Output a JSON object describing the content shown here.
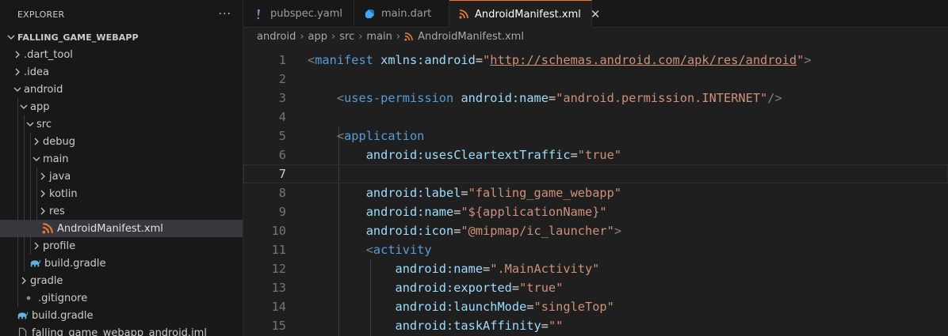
{
  "explorer": {
    "title": "EXPLORER",
    "more": "···",
    "root": "FALLING_GAME_WEBAPP",
    "items": [
      {
        "label": ".dart_tool",
        "state": "closed"
      },
      {
        "label": ".idea",
        "state": "closed"
      },
      {
        "label": "android",
        "state": "open"
      },
      {
        "label": "app",
        "state": "open"
      },
      {
        "label": "src",
        "state": "open"
      },
      {
        "label": "debug",
        "state": "closed"
      },
      {
        "label": "main",
        "state": "open"
      },
      {
        "label": "java",
        "state": "closed"
      },
      {
        "label": "kotlin",
        "state": "closed"
      },
      {
        "label": "res",
        "state": "closed"
      },
      {
        "label": "AndroidManifest.xml",
        "icon": "rss-icon",
        "selected": true
      },
      {
        "label": "profile",
        "state": "closed"
      },
      {
        "label": "build.gradle",
        "icon": "gradle-elephant-icon"
      },
      {
        "label": "gradle",
        "state": "closed"
      },
      {
        "label": ".gitignore",
        "icon": "git-dot-icon"
      },
      {
        "label": "build.gradle",
        "icon": "gradle-elephant-icon"
      },
      {
        "label": "falling_game_webapp_android.iml",
        "icon": "file-icon"
      }
    ]
  },
  "tabs": [
    {
      "label": "pubspec.yaml",
      "icon": "exclamation-icon"
    },
    {
      "label": "main.dart",
      "icon": "dart-icon"
    },
    {
      "label": "AndroidManifest.xml",
      "icon": "rss-icon",
      "active": true,
      "close": "✕"
    }
  ],
  "breadcrumb": [
    "android",
    "app",
    "src",
    "main",
    "AndroidManifest.xml"
  ],
  "colors": {
    "tag": "#569cd6",
    "attr": "#9cdcfe",
    "string": "#ce9178",
    "punct": "#808080",
    "xml_icon": "#e37933",
    "gradle_icon": "#5fb4e3",
    "yaml_icon": "#a074c4",
    "active_tab_border": "#f07833"
  },
  "code": {
    "current_line": 7,
    "lines": [
      {
        "num": "1",
        "tokens": [
          [
            "punc",
            "<"
          ],
          [
            "tag",
            "manifest"
          ],
          [
            "eq",
            " "
          ],
          [
            "attr",
            "xmlns:android"
          ],
          [
            "eq",
            "="
          ],
          [
            "str",
            "\""
          ],
          [
            "url",
            "http://schemas.android.com/apk/res/android"
          ],
          [
            "str",
            "\""
          ],
          [
            "punc",
            ">"
          ]
        ]
      },
      {
        "num": "2",
        "tokens": []
      },
      {
        "num": "3",
        "tokens": [
          [
            "eq",
            "    "
          ],
          [
            "punc",
            "<"
          ],
          [
            "tag",
            "uses-permission"
          ],
          [
            "eq",
            " "
          ],
          [
            "attr",
            "android:name"
          ],
          [
            "eq",
            "="
          ],
          [
            "str",
            "\"android.permission.INTERNET\""
          ],
          [
            "punc",
            "/>"
          ]
        ]
      },
      {
        "num": "4",
        "tokens": []
      },
      {
        "num": "5",
        "tokens": [
          [
            "eq",
            "    "
          ],
          [
            "punc",
            "<"
          ],
          [
            "tag",
            "application"
          ]
        ]
      },
      {
        "num": "6",
        "tokens": [
          [
            "eq",
            "        "
          ],
          [
            "attr",
            "android:usesCleartextTraffic"
          ],
          [
            "eq",
            "="
          ],
          [
            "str",
            "\"true\""
          ]
        ]
      },
      {
        "num": "7",
        "tokens": []
      },
      {
        "num": "8",
        "tokens": [
          [
            "eq",
            "        "
          ],
          [
            "attr",
            "android:label"
          ],
          [
            "eq",
            "="
          ],
          [
            "str",
            "\"falling_game_webapp\""
          ]
        ]
      },
      {
        "num": "9",
        "tokens": [
          [
            "eq",
            "        "
          ],
          [
            "attr",
            "android:name"
          ],
          [
            "eq",
            "="
          ],
          [
            "str",
            "\"${applicationName}\""
          ]
        ]
      },
      {
        "num": "10",
        "tokens": [
          [
            "eq",
            "        "
          ],
          [
            "attr",
            "android:icon"
          ],
          [
            "eq",
            "="
          ],
          [
            "str",
            "\"@mipmap/ic_launcher\""
          ],
          [
            "punc",
            ">"
          ]
        ]
      },
      {
        "num": "11",
        "tokens": [
          [
            "eq",
            "        "
          ],
          [
            "punc",
            "<"
          ],
          [
            "tag",
            "activity"
          ]
        ]
      },
      {
        "num": "12",
        "tokens": [
          [
            "eq",
            "            "
          ],
          [
            "attr",
            "android:name"
          ],
          [
            "eq",
            "="
          ],
          [
            "str",
            "\".MainActivity\""
          ]
        ]
      },
      {
        "num": "13",
        "tokens": [
          [
            "eq",
            "            "
          ],
          [
            "attr",
            "android:exported"
          ],
          [
            "eq",
            "="
          ],
          [
            "str",
            "\"true\""
          ]
        ]
      },
      {
        "num": "14",
        "tokens": [
          [
            "eq",
            "            "
          ],
          [
            "attr",
            "android:launchMode"
          ],
          [
            "eq",
            "="
          ],
          [
            "str",
            "\"singleTop\""
          ]
        ]
      },
      {
        "num": "15",
        "tokens": [
          [
            "eq",
            "            "
          ],
          [
            "attr",
            "android:taskAffinity"
          ],
          [
            "eq",
            "="
          ],
          [
            "str",
            "\"\""
          ]
        ]
      }
    ]
  }
}
